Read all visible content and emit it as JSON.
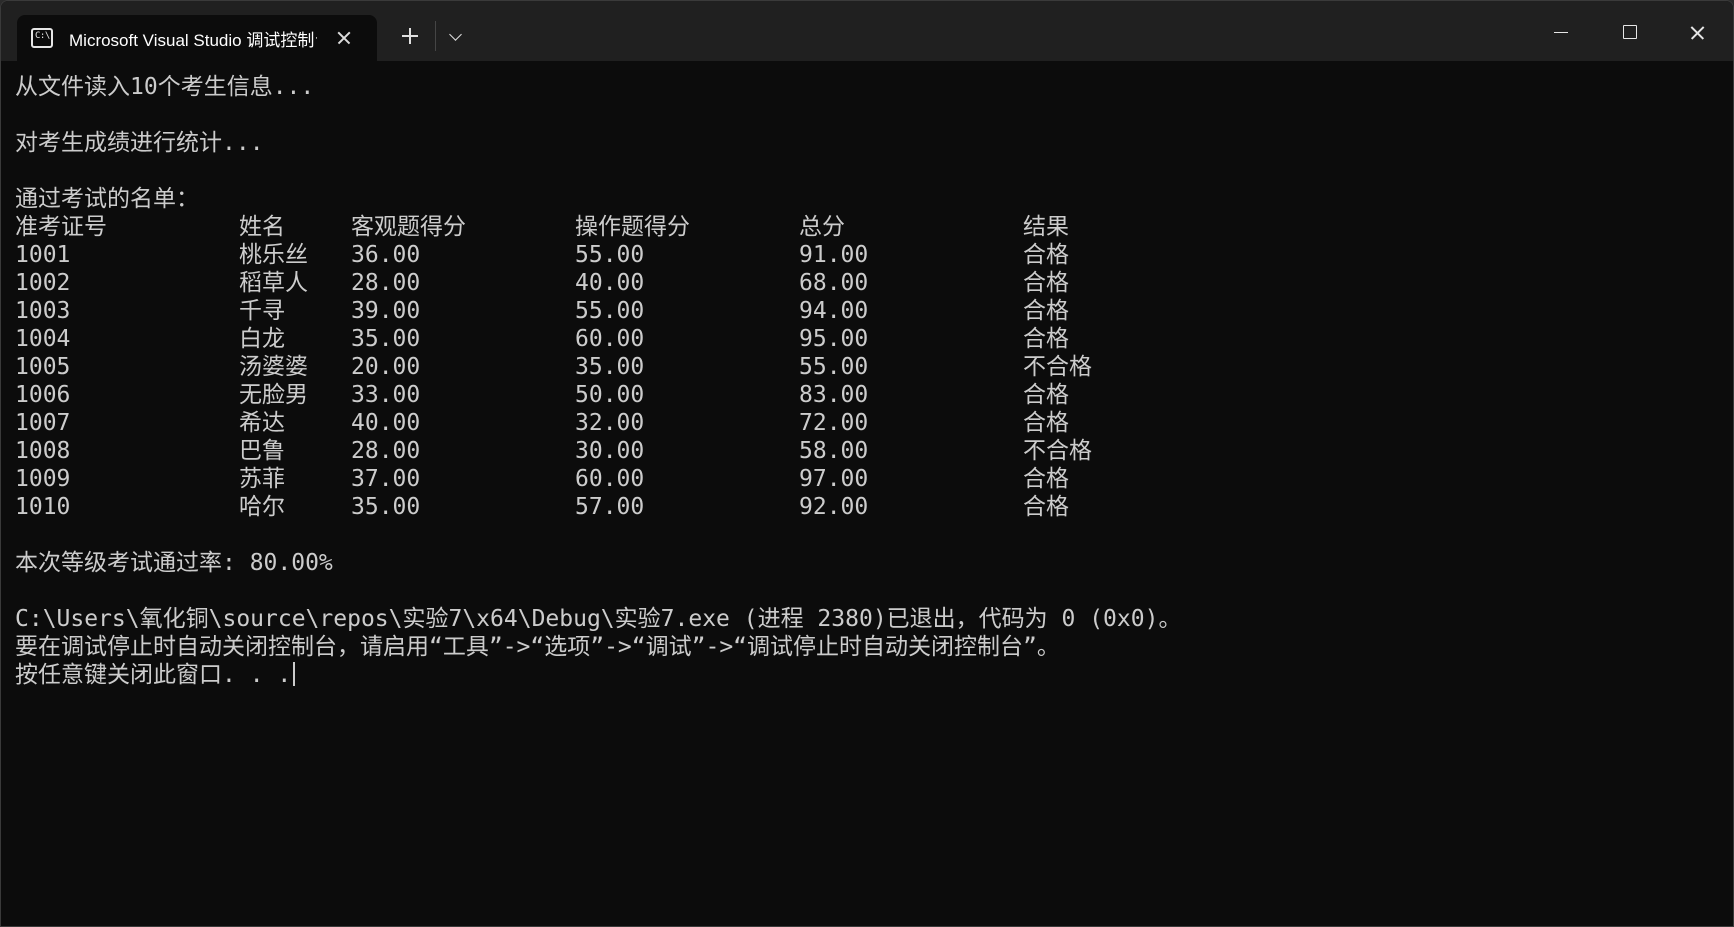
{
  "window": {
    "tab_title": "Microsoft Visual Studio 调试控制台",
    "tab_icon": "console-icon",
    "tab_icon_text": "C:\\"
  },
  "console": {
    "line_read": "从文件读入10个考生信息...",
    "line_stats": "对考生成绩进行统计...",
    "line_pass_list": "通过考试的名单：",
    "table_headers": [
      "准考证号",
      "姓名",
      "客观题得分",
      "操作题得分",
      "总分",
      "结果"
    ],
    "rows": [
      {
        "id": "1001",
        "name": "桃乐丝",
        "objective": "36.00",
        "practical": "55.00",
        "total": "91.00",
        "result": "合格"
      },
      {
        "id": "1002",
        "name": "稻草人",
        "objective": "28.00",
        "practical": "40.00",
        "total": "68.00",
        "result": "合格"
      },
      {
        "id": "1003",
        "name": "千寻",
        "objective": "39.00",
        "practical": "55.00",
        "total": "94.00",
        "result": "合格"
      },
      {
        "id": "1004",
        "name": "白龙",
        "objective": "35.00",
        "practical": "60.00",
        "total": "95.00",
        "result": "合格"
      },
      {
        "id": "1005",
        "name": "汤婆婆",
        "objective": "20.00",
        "practical": "35.00",
        "total": "55.00",
        "result": "不合格"
      },
      {
        "id": "1006",
        "name": "无脸男",
        "objective": "33.00",
        "practical": "50.00",
        "total": "83.00",
        "result": "合格"
      },
      {
        "id": "1007",
        "name": "希达",
        "objective": "40.00",
        "practical": "32.00",
        "total": "72.00",
        "result": "合格"
      },
      {
        "id": "1008",
        "name": "巴鲁",
        "objective": "28.00",
        "practical": "30.00",
        "total": "58.00",
        "result": "不合格"
      },
      {
        "id": "1009",
        "name": "苏菲",
        "objective": "37.00",
        "practical": "60.00",
        "total": "97.00",
        "result": "合格"
      },
      {
        "id": "1010",
        "name": "哈尔",
        "objective": "35.00",
        "practical": "57.00",
        "total": "92.00",
        "result": "合格"
      }
    ],
    "pass_rate_line": "本次等级考试通过率: 80.00%",
    "exit_line": "C:\\Users\\氧化铜\\source\\repos\\实验7\\x64\\Debug\\实验7.exe (进程 2380)已退出，代码为 0 (0x0)。",
    "auto_close_line": "要在调试停止时自动关闭控制台，请启用“工具”->“选项”->“调试”->“调试停止时自动关闭控制台”。",
    "press_key_line": "按任意键关闭此窗口. . ."
  }
}
